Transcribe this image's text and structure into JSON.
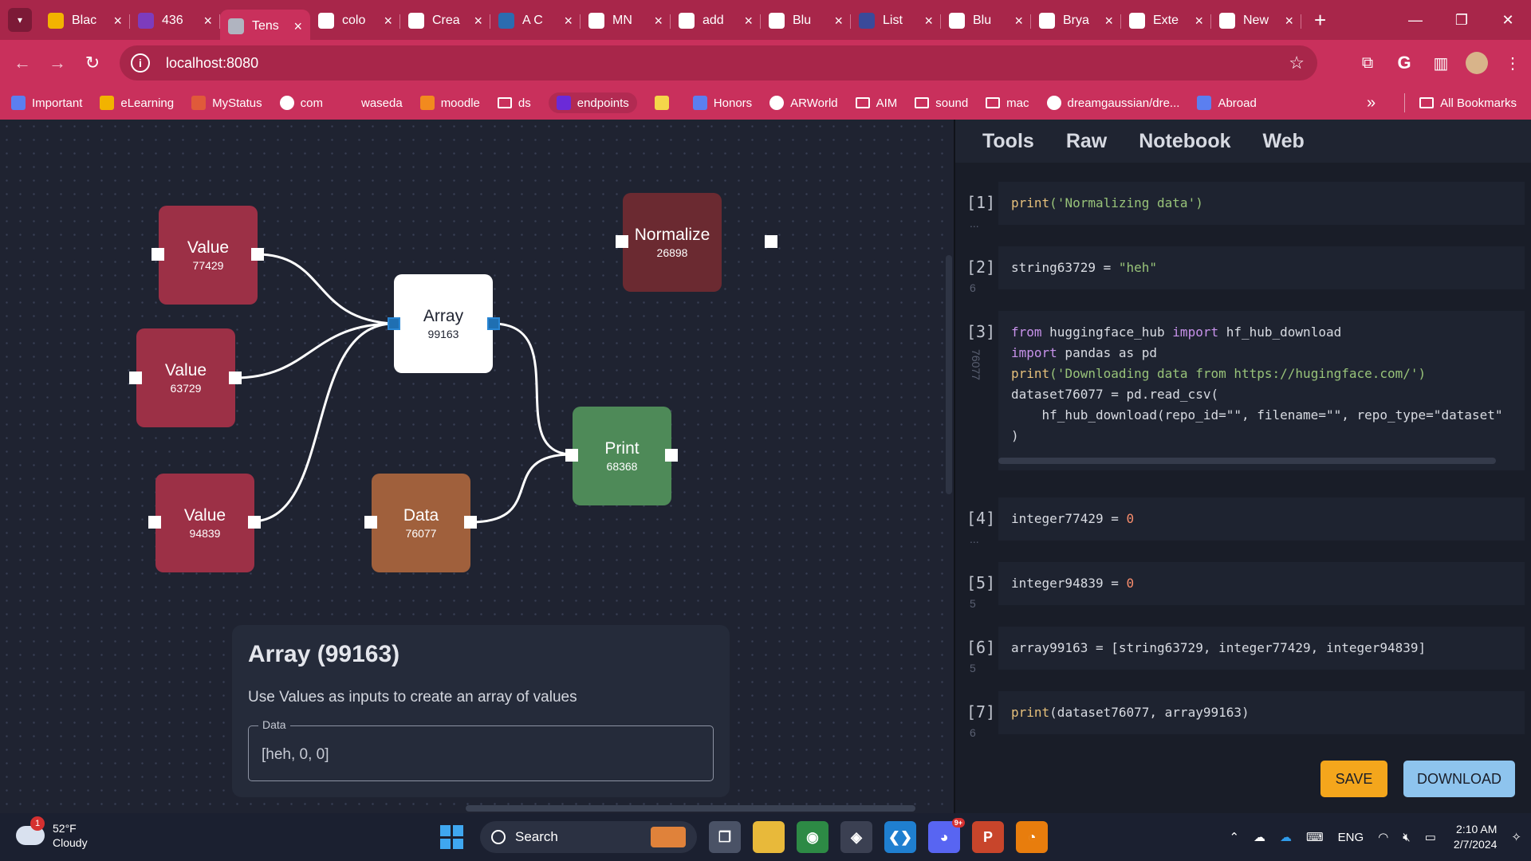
{
  "browser": {
    "tabs": [
      {
        "title": "Blac",
        "icon": "bar-chart-icon",
        "color": "#f2b300"
      },
      {
        "title": "436",
        "icon": "onenote-icon",
        "color": "#7d3cbd"
      },
      {
        "title": "Tens",
        "icon": "globe-icon",
        "color": "#b0b4c0",
        "active": true
      },
      {
        "title": "colo",
        "icon": "google-icon",
        "color": "#ffffff"
      },
      {
        "title": "Crea",
        "icon": "google-icon",
        "color": "#ffffff"
      },
      {
        "title": "A C",
        "icon": "dds-icon",
        "color": "#2b6cb0"
      },
      {
        "title": "MN",
        "icon": "github-icon",
        "color": "#ffffff"
      },
      {
        "title": "add",
        "icon": "google-icon",
        "color": "#ffffff"
      },
      {
        "title": "Blu",
        "icon": "github-icon",
        "color": "#ffffff"
      },
      {
        "title": "List",
        "icon": "list-icon",
        "color": "#3a4a9a"
      },
      {
        "title": "Blu",
        "icon": "github-icon",
        "color": "#ffffff"
      },
      {
        "title": "Brya",
        "icon": "google-icon",
        "color": "#ffffff"
      },
      {
        "title": "Exte",
        "icon": "puzzle-icon",
        "color": "#ffffff"
      },
      {
        "title": "New",
        "icon": "chrome-icon",
        "color": "#ffffff"
      }
    ],
    "url": "localhost:8080",
    "bookmarks": [
      {
        "label": "Important",
        "icon": "doc-icon"
      },
      {
        "label": "eLearning",
        "icon": "bar-chart-icon"
      },
      {
        "label": "MyStatus",
        "icon": "shield-icon"
      },
      {
        "label": "com",
        "icon": "kh-icon"
      },
      {
        "label": "waseda",
        "icon": "blank-icon"
      },
      {
        "label": "moodle",
        "icon": "moodle-icon"
      },
      {
        "label": "ds",
        "icon": "folder-icon"
      },
      {
        "label": "endpoints",
        "icon": "endpoints-icon"
      },
      {
        "label": "",
        "icon": "emoji-icon"
      },
      {
        "label": "Honors",
        "icon": "doc-icon"
      },
      {
        "label": "ARWorld",
        "icon": "github-icon"
      },
      {
        "label": "AIM",
        "icon": "folder-icon"
      },
      {
        "label": "sound",
        "icon": "folder-icon"
      },
      {
        "label": "mac",
        "icon": "folder-icon"
      },
      {
        "label": "dreamgaussian/dre...",
        "icon": "github-icon"
      },
      {
        "label": "Abroad",
        "icon": "doc-icon"
      }
    ],
    "all_bookmarks": "All Bookmarks"
  },
  "canvas": {
    "nodes": [
      {
        "label": "Value",
        "id": "77429",
        "color": "#9c3046"
      },
      {
        "label": "Value",
        "id": "63729",
        "color": "#9c3046"
      },
      {
        "label": "Value",
        "id": "94839",
        "color": "#9c3046"
      },
      {
        "label": "Array",
        "id": "99163",
        "color": "#ffffff"
      },
      {
        "label": "Normalize",
        "id": "26898",
        "color": "#6b2a31"
      },
      {
        "label": "Data",
        "id": "76077",
        "color": "#a0603c"
      },
      {
        "label": "Print",
        "id": "68368",
        "color": "#4e8a58"
      }
    ],
    "panel": {
      "title": "Array (99163)",
      "description": "Use Values as inputs to create an array of values",
      "field_label": "Data",
      "field_value": "[heh, 0, 0]"
    }
  },
  "notebook": {
    "tabs": [
      "Tools",
      "Raw",
      "Notebook",
      "Web"
    ],
    "cells": [
      {
        "num": "[1]:",
        "gutter": "..."
      },
      {
        "num": "[2]:",
        "gutter": "6"
      },
      {
        "num": "[3]:",
        "gutter": "76077"
      },
      {
        "num": "[4]:",
        "gutter": "..."
      },
      {
        "num": "[5]:",
        "gutter": "5"
      },
      {
        "num": "[6]:",
        "gutter": "5"
      },
      {
        "num": "[7]:",
        "gutter": "6"
      }
    ],
    "code": {
      "c1_print": "print",
      "c1_str": "('Normalizing data')",
      "c2_var": "string63729 = ",
      "c2_str": "\"heh\"",
      "c3_l1_kw": "from",
      "c3_l1_mod": " huggingface_hub ",
      "c3_l1_kw2": "import",
      "c3_l1_name": " hf_hub_download",
      "c3_l2_kw": "import",
      "c3_l2_rest": " pandas as pd",
      "c3_l3_print": "print",
      "c3_l3_str": "('Downloading data from https://hugingface.com/')",
      "c3_l4": "dataset76077 = pd.read_csv(",
      "c3_l5": "    hf_hub_download(repo_id=\"\", filename=\"\", repo_type=\"dataset\"",
      "c3_l6": ")",
      "c4_var": "integer77429 = ",
      "c4_num": "0",
      "c5_var": "integer94839 = ",
      "c5_num": "0",
      "c6": "array99163 = [string63729, integer77429, integer94839]",
      "c7_print": "print",
      "c7_rest": "(dataset76077, array99163)"
    },
    "save_label": "SAVE",
    "download_label": "DOWNLOAD"
  },
  "taskbar": {
    "notification_count": "1",
    "temperature": "52°F",
    "condition": "Cloudy",
    "search_label": "Search",
    "discord_badge": "9+",
    "language": "ENG",
    "time": "2:10 AM",
    "date": "2/7/2024"
  }
}
